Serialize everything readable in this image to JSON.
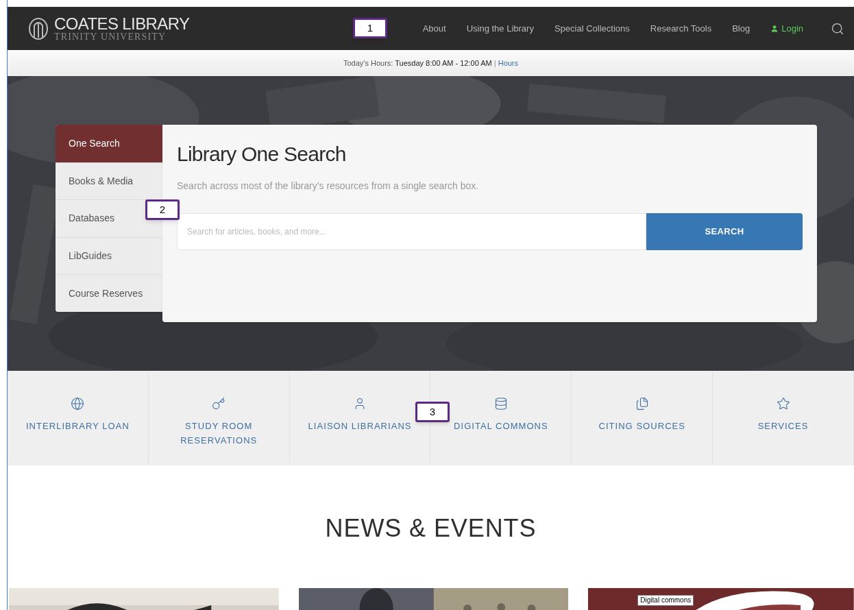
{
  "header": {
    "logo_title": "COATES LIBRARY",
    "logo_subtitle": "TRINITY UNIVERSITY",
    "nav": [
      {
        "label": "About",
        "kind": "link"
      },
      {
        "label": "Using the Library",
        "kind": "link"
      },
      {
        "label": "Special Collections",
        "kind": "link"
      },
      {
        "label": "Research Tools",
        "kind": "link"
      },
      {
        "label": "Blog",
        "kind": "link"
      },
      {
        "label": "Login",
        "kind": "login"
      }
    ]
  },
  "hours": {
    "label": "Today's Hours:",
    "value": "Tuesday 8:00 AM - 12:00 AM",
    "separator": "|",
    "link": "Hours"
  },
  "search_tabs": [
    {
      "label": "One Search",
      "selected": true
    },
    {
      "label": "Books & Media",
      "selected": false
    },
    {
      "label": "Databases",
      "selected": false
    },
    {
      "label": "LibGuides",
      "selected": false
    },
    {
      "label": "Course Reserves",
      "selected": false
    }
  ],
  "search_panel": {
    "title": "Library One Search",
    "description": "Search across most of the library’s resources from a single search box.",
    "placeholder": "Search for articles, books, and more...",
    "button": "SEARCH"
  },
  "quick_links": [
    {
      "label": "INTERLIBRARY LOAN"
    },
    {
      "label": "STUDY ROOM RESERVATIONS"
    },
    {
      "label": "LIAISON LIBRARIANS"
    },
    {
      "label": "DIGITAL COMMONS"
    },
    {
      "label": "CITING SOURCES"
    },
    {
      "label": "SERVICES"
    }
  ],
  "news": {
    "title": "NEWS & EVENTS",
    "cards": [
      {
        "kind": "picture"
      },
      {
        "kind": "picture"
      },
      {
        "kind": "picture",
        "tooltip": "Digital commons"
      }
    ]
  },
  "callouts": [
    {
      "label": "1"
    },
    {
      "label": "2"
    },
    {
      "label": "3"
    }
  ]
}
